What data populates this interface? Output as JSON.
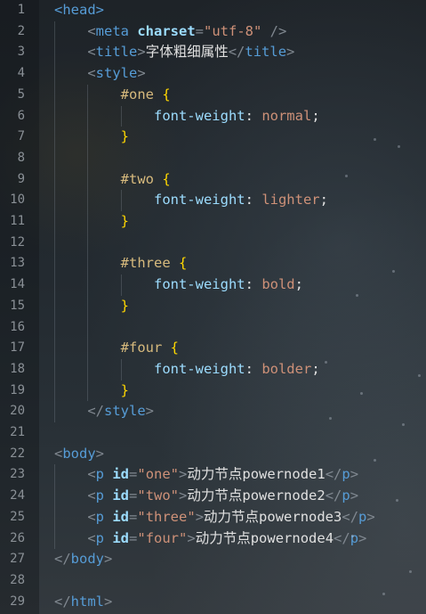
{
  "editor": {
    "lines": [
      {
        "n": "1",
        "segs": [
          [
            "tag",
            "<head>"
          ]
        ]
      },
      {
        "n": "2",
        "segs": [
          [
            "sp",
            "    "
          ],
          [
            "punc",
            "<"
          ],
          [
            "tag",
            "meta "
          ],
          [
            "attr",
            "charset"
          ],
          [
            "punc",
            "="
          ],
          [
            "str",
            "\"utf-8\""
          ],
          [
            "punc",
            " />"
          ]
        ]
      },
      {
        "n": "3",
        "segs": [
          [
            "sp",
            "    "
          ],
          [
            "punc",
            "<"
          ],
          [
            "tag",
            "title"
          ],
          [
            "punc",
            ">"
          ],
          [
            "txt",
            "字体粗细属性"
          ],
          [
            "punc",
            "</"
          ],
          [
            "tag",
            "title"
          ],
          [
            "punc",
            ">"
          ]
        ]
      },
      {
        "n": "4",
        "segs": [
          [
            "sp",
            "    "
          ],
          [
            "punc",
            "<"
          ],
          [
            "tag",
            "style"
          ],
          [
            "punc",
            ">"
          ]
        ]
      },
      {
        "n": "5",
        "segs": [
          [
            "sp",
            "        "
          ],
          [
            "sel",
            "#one "
          ],
          [
            "brace",
            "{"
          ]
        ]
      },
      {
        "n": "6",
        "segs": [
          [
            "sp",
            "            "
          ],
          [
            "prop",
            "font-weight"
          ],
          [
            "txt",
            ": "
          ],
          [
            "val",
            "normal"
          ],
          [
            "txt",
            ";"
          ]
        ]
      },
      {
        "n": "7",
        "segs": [
          [
            "sp",
            "        "
          ],
          [
            "brace",
            "}"
          ]
        ]
      },
      {
        "n": "8",
        "segs": []
      },
      {
        "n": "9",
        "segs": [
          [
            "sp",
            "        "
          ],
          [
            "sel",
            "#two "
          ],
          [
            "brace",
            "{"
          ]
        ]
      },
      {
        "n": "10",
        "segs": [
          [
            "sp",
            "            "
          ],
          [
            "prop",
            "font-weight"
          ],
          [
            "txt",
            ": "
          ],
          [
            "val",
            "lighter"
          ],
          [
            "txt",
            ";"
          ]
        ]
      },
      {
        "n": "11",
        "segs": [
          [
            "sp",
            "        "
          ],
          [
            "brace",
            "}"
          ]
        ]
      },
      {
        "n": "12",
        "segs": []
      },
      {
        "n": "13",
        "segs": [
          [
            "sp",
            "        "
          ],
          [
            "sel",
            "#three "
          ],
          [
            "brace",
            "{"
          ]
        ]
      },
      {
        "n": "14",
        "segs": [
          [
            "sp",
            "            "
          ],
          [
            "prop",
            "font-weight"
          ],
          [
            "txt",
            ": "
          ],
          [
            "val",
            "bold"
          ],
          [
            "txt",
            ";"
          ]
        ]
      },
      {
        "n": "15",
        "segs": [
          [
            "sp",
            "        "
          ],
          [
            "brace",
            "}"
          ]
        ]
      },
      {
        "n": "16",
        "segs": []
      },
      {
        "n": "17",
        "segs": [
          [
            "sp",
            "        "
          ],
          [
            "sel",
            "#four "
          ],
          [
            "brace",
            "{"
          ]
        ]
      },
      {
        "n": "18",
        "segs": [
          [
            "sp",
            "            "
          ],
          [
            "prop",
            "font-weight"
          ],
          [
            "txt",
            ": "
          ],
          [
            "val",
            "bolder"
          ],
          [
            "txt",
            ";"
          ]
        ]
      },
      {
        "n": "19",
        "segs": [
          [
            "sp",
            "        "
          ],
          [
            "brace",
            "}"
          ]
        ]
      },
      {
        "n": "20",
        "segs": [
          [
            "sp",
            "    "
          ],
          [
            "punc",
            "</"
          ],
          [
            "tag",
            "style"
          ],
          [
            "punc",
            ">"
          ]
        ]
      },
      {
        "n": "21",
        "segs": []
      },
      {
        "n": "22",
        "segs": [
          [
            "punc",
            "<"
          ],
          [
            "tag",
            "body"
          ],
          [
            "punc",
            ">"
          ]
        ]
      },
      {
        "n": "23",
        "segs": [
          [
            "sp",
            "    "
          ],
          [
            "punc",
            "<"
          ],
          [
            "tag",
            "p "
          ],
          [
            "attr",
            "id"
          ],
          [
            "punc",
            "="
          ],
          [
            "str",
            "\"one\""
          ],
          [
            "punc",
            ">"
          ],
          [
            "txt",
            "动力节点powernode1"
          ],
          [
            "punc",
            "</"
          ],
          [
            "tag",
            "p"
          ],
          [
            "punc",
            ">"
          ]
        ]
      },
      {
        "n": "24",
        "segs": [
          [
            "sp",
            "    "
          ],
          [
            "punc",
            "<"
          ],
          [
            "tag",
            "p "
          ],
          [
            "attr",
            "id"
          ],
          [
            "punc",
            "="
          ],
          [
            "str",
            "\"two\""
          ],
          [
            "punc",
            ">"
          ],
          [
            "txt",
            "动力节点powernode2"
          ],
          [
            "punc",
            "</"
          ],
          [
            "tag",
            "p"
          ],
          [
            "punc",
            ">"
          ]
        ]
      },
      {
        "n": "25",
        "segs": [
          [
            "sp",
            "    "
          ],
          [
            "punc",
            "<"
          ],
          [
            "tag",
            "p "
          ],
          [
            "attr",
            "id"
          ],
          [
            "punc",
            "="
          ],
          [
            "str",
            "\"three\""
          ],
          [
            "punc",
            ">"
          ],
          [
            "txt",
            "动力节点powernode3"
          ],
          [
            "punc",
            "</"
          ],
          [
            "tag",
            "p"
          ],
          [
            "punc",
            ">"
          ]
        ]
      },
      {
        "n": "26",
        "segs": [
          [
            "sp",
            "    "
          ],
          [
            "punc",
            "<"
          ],
          [
            "tag",
            "p "
          ],
          [
            "attr",
            "id"
          ],
          [
            "punc",
            "="
          ],
          [
            "str",
            "\"four\""
          ],
          [
            "punc",
            ">"
          ],
          [
            "txt",
            "动力节点powernode4"
          ],
          [
            "punc",
            "</"
          ],
          [
            "tag",
            "p"
          ],
          [
            "punc",
            ">"
          ]
        ]
      },
      {
        "n": "27",
        "segs": [
          [
            "punc",
            "</"
          ],
          [
            "tag",
            "body"
          ],
          [
            "punc",
            ">"
          ]
        ]
      },
      {
        "n": "28",
        "segs": []
      },
      {
        "n": "29",
        "segs": [
          [
            "punc",
            "</"
          ],
          [
            "tag",
            "html"
          ],
          [
            "punc",
            ">"
          ]
        ]
      }
    ]
  }
}
